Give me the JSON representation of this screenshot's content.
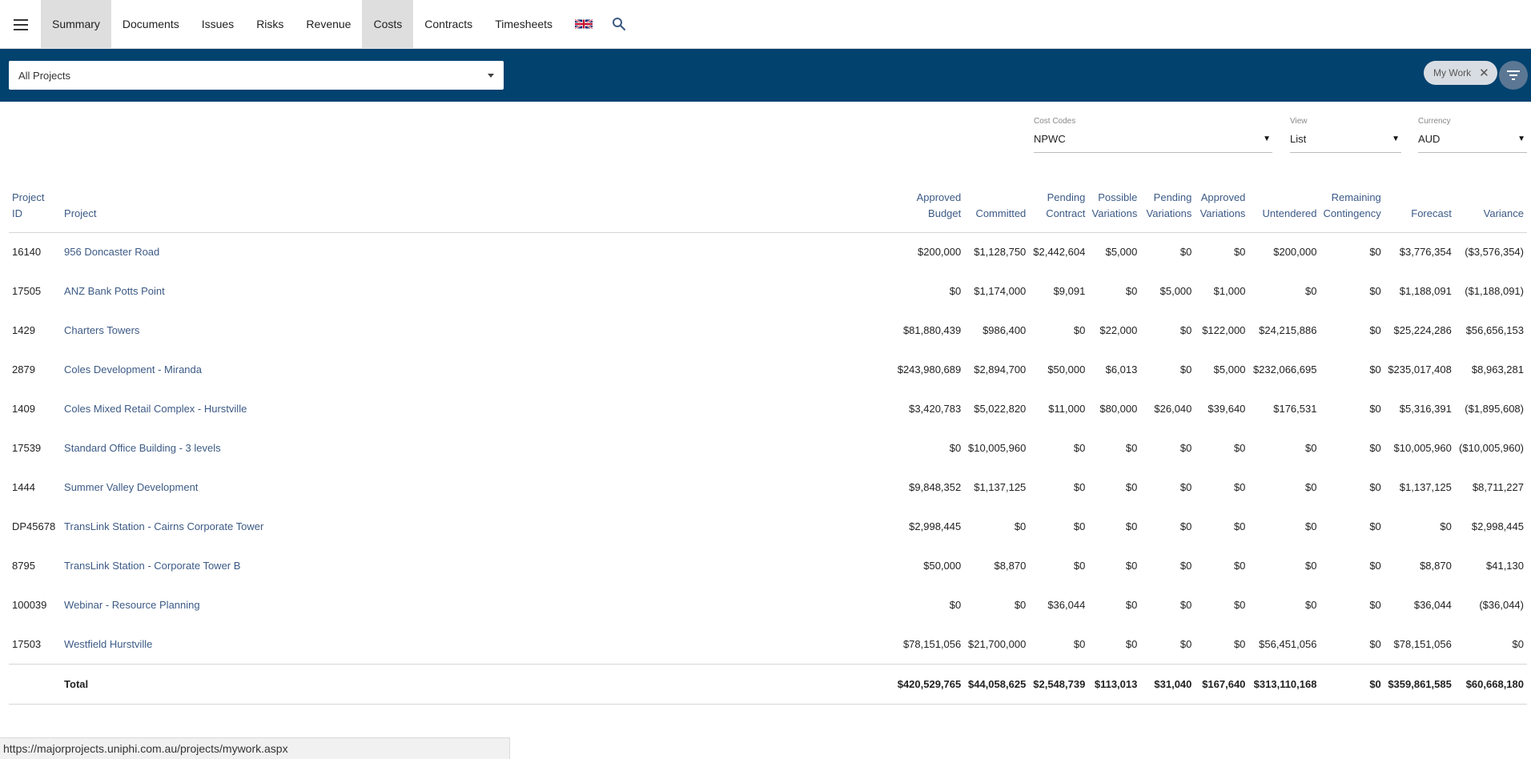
{
  "nav": {
    "tabs": [
      {
        "label": "Summary",
        "active": true
      },
      {
        "label": "Documents",
        "active": false
      },
      {
        "label": "Issues",
        "active": false
      },
      {
        "label": "Risks",
        "active": false
      },
      {
        "label": "Revenue",
        "active": false
      },
      {
        "label": "Costs",
        "active": true
      },
      {
        "label": "Contracts",
        "active": false
      },
      {
        "label": "Timesheets",
        "active": false
      }
    ]
  },
  "filterbar": {
    "project_select": "All Projects",
    "chip_label": "My Work"
  },
  "selectors": {
    "cost_codes": {
      "label": "Cost Codes",
      "value": "NPWC"
    },
    "view": {
      "label": "View",
      "value": "List"
    },
    "currency": {
      "label": "Currency",
      "value": "AUD"
    }
  },
  "table": {
    "headers": {
      "project_id": "Project ID",
      "project": "Project",
      "approved_budget": [
        "Approved",
        "Budget"
      ],
      "committed": "Committed",
      "pending_contract": [
        "Pending",
        "Contract"
      ],
      "possible_variations": [
        "Possible",
        "Variations"
      ],
      "pending_variations": [
        "Pending",
        "Variations"
      ],
      "approved_variations": [
        "Approved",
        "Variations"
      ],
      "untendered": "Untendered",
      "remaining_contingency": [
        "Remaining",
        "Contingency"
      ],
      "forecast": "Forecast",
      "variance": "Variance"
    },
    "rows": [
      {
        "id": "16140",
        "name": "956 Doncaster Road",
        "approved_budget": "$200,000",
        "committed": "$1,128,750",
        "pending_contract": "$2,442,604",
        "possible_variations": "$5,000",
        "pending_variations": "$0",
        "approved_variations": "$0",
        "untendered": "$200,000",
        "remaining_contingency": "$0",
        "forecast": "$3,776,354",
        "variance": "($3,576,354)"
      },
      {
        "id": "17505",
        "name": "ANZ Bank Potts Point",
        "approved_budget": "$0",
        "committed": "$1,174,000",
        "pending_contract": "$9,091",
        "possible_variations": "$0",
        "pending_variations": "$5,000",
        "approved_variations": "$1,000",
        "untendered": "$0",
        "remaining_contingency": "$0",
        "forecast": "$1,188,091",
        "variance": "($1,188,091)"
      },
      {
        "id": "1429",
        "name": "Charters Towers",
        "approved_budget": "$81,880,439",
        "committed": "$986,400",
        "pending_contract": "$0",
        "possible_variations": "$22,000",
        "pending_variations": "$0",
        "approved_variations": "$122,000",
        "untendered": "$24,215,886",
        "remaining_contingency": "$0",
        "forecast": "$25,224,286",
        "variance": "$56,656,153"
      },
      {
        "id": "2879",
        "name": "Coles Development - Miranda",
        "approved_budget": "$243,980,689",
        "committed": "$2,894,700",
        "pending_contract": "$50,000",
        "possible_variations": "$6,013",
        "pending_variations": "$0",
        "approved_variations": "$5,000",
        "untendered": "$232,066,695",
        "remaining_contingency": "$0",
        "forecast": "$235,017,408",
        "variance": "$8,963,281"
      },
      {
        "id": "1409",
        "name": "Coles Mixed Retail Complex - Hurstville",
        "approved_budget": "$3,420,783",
        "committed": "$5,022,820",
        "pending_contract": "$11,000",
        "possible_variations": "$80,000",
        "pending_variations": "$26,040",
        "approved_variations": "$39,640",
        "untendered": "$176,531",
        "remaining_contingency": "$0",
        "forecast": "$5,316,391",
        "variance": "($1,895,608)"
      },
      {
        "id": "17539",
        "name": "Standard Office Building - 3 levels",
        "approved_budget": "$0",
        "committed": "$10,005,960",
        "pending_contract": "$0",
        "possible_variations": "$0",
        "pending_variations": "$0",
        "approved_variations": "$0",
        "untendered": "$0",
        "remaining_contingency": "$0",
        "forecast": "$10,005,960",
        "variance": "($10,005,960)"
      },
      {
        "id": "1444",
        "name": "Summer Valley Development",
        "approved_budget": "$9,848,352",
        "committed": "$1,137,125",
        "pending_contract": "$0",
        "possible_variations": "$0",
        "pending_variations": "$0",
        "approved_variations": "$0",
        "untendered": "$0",
        "remaining_contingency": "$0",
        "forecast": "$1,137,125",
        "variance": "$8,711,227"
      },
      {
        "id": "DP45678",
        "name": "TransLink Station - Cairns Corporate Tower",
        "approved_budget": "$2,998,445",
        "committed": "$0",
        "pending_contract": "$0",
        "possible_variations": "$0",
        "pending_variations": "$0",
        "approved_variations": "$0",
        "untendered": "$0",
        "remaining_contingency": "$0",
        "forecast": "$0",
        "variance": "$2,998,445"
      },
      {
        "id": "8795",
        "name": "TransLink Station - Corporate Tower B",
        "approved_budget": "$50,000",
        "committed": "$8,870",
        "pending_contract": "$0",
        "possible_variations": "$0",
        "pending_variations": "$0",
        "approved_variations": "$0",
        "untendered": "$0",
        "remaining_contingency": "$0",
        "forecast": "$8,870",
        "variance": "$41,130"
      },
      {
        "id": "100039",
        "name": "Webinar - Resource Planning",
        "approved_budget": "$0",
        "committed": "$0",
        "pending_contract": "$36,044",
        "possible_variations": "$0",
        "pending_variations": "$0",
        "approved_variations": "$0",
        "untendered": "$0",
        "remaining_contingency": "$0",
        "forecast": "$36,044",
        "variance": "($36,044)"
      },
      {
        "id": "17503",
        "name": "Westfield Hurstville",
        "approved_budget": "$78,151,056",
        "committed": "$21,700,000",
        "pending_contract": "$0",
        "possible_variations": "$0",
        "pending_variations": "$0",
        "approved_variations": "$0",
        "untendered": "$56,451,056",
        "remaining_contingency": "$0",
        "forecast": "$78,151,056",
        "variance": "$0"
      }
    ],
    "total": {
      "label": "Total",
      "approved_budget": "$420,529,765",
      "committed": "$44,058,625",
      "pending_contract": "$2,548,739",
      "possible_variations": "$113,013",
      "pending_variations": "$31,040",
      "approved_variations": "$167,640",
      "untendered": "$313,110,168",
      "remaining_contingency": "$0",
      "forecast": "$359,861,585",
      "variance": "$60,668,180"
    }
  },
  "status_url": "https://majorprojects.uniphi.com.au/projects/mywork.aspx"
}
